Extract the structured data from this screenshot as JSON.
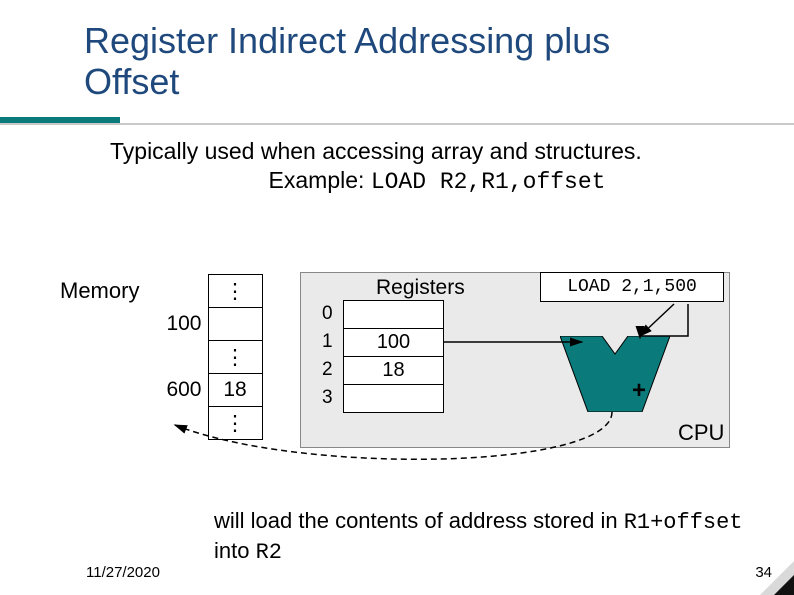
{
  "title_line1": "Register Indirect Addressing plus",
  "title_line2": "Offset",
  "body_line1": "Typically used when accessing array and structures.",
  "body_line2_prefix": "Example: ",
  "body_line2_code": "LOAD R2,R1,offset",
  "memory": {
    "label": "Memory",
    "rows": [
      "⋮",
      "",
      "⋮",
      "18",
      "⋮"
    ],
    "addrs": [
      "",
      "100",
      "",
      "600",
      ""
    ]
  },
  "registers": {
    "label": "Registers",
    "idx": [
      "0",
      "1",
      "2",
      "3"
    ],
    "vals": [
      "",
      "100",
      "18",
      ""
    ]
  },
  "instruction": "LOAD 2,1,500",
  "plus": "+",
  "cpu_label": "CPU",
  "explain_pre": "will load the contents of address stored in ",
  "explain_code1": "R1+offset",
  "explain_mid": " into ",
  "explain_code2": "R2",
  "date": "11/27/2020",
  "page": "34"
}
